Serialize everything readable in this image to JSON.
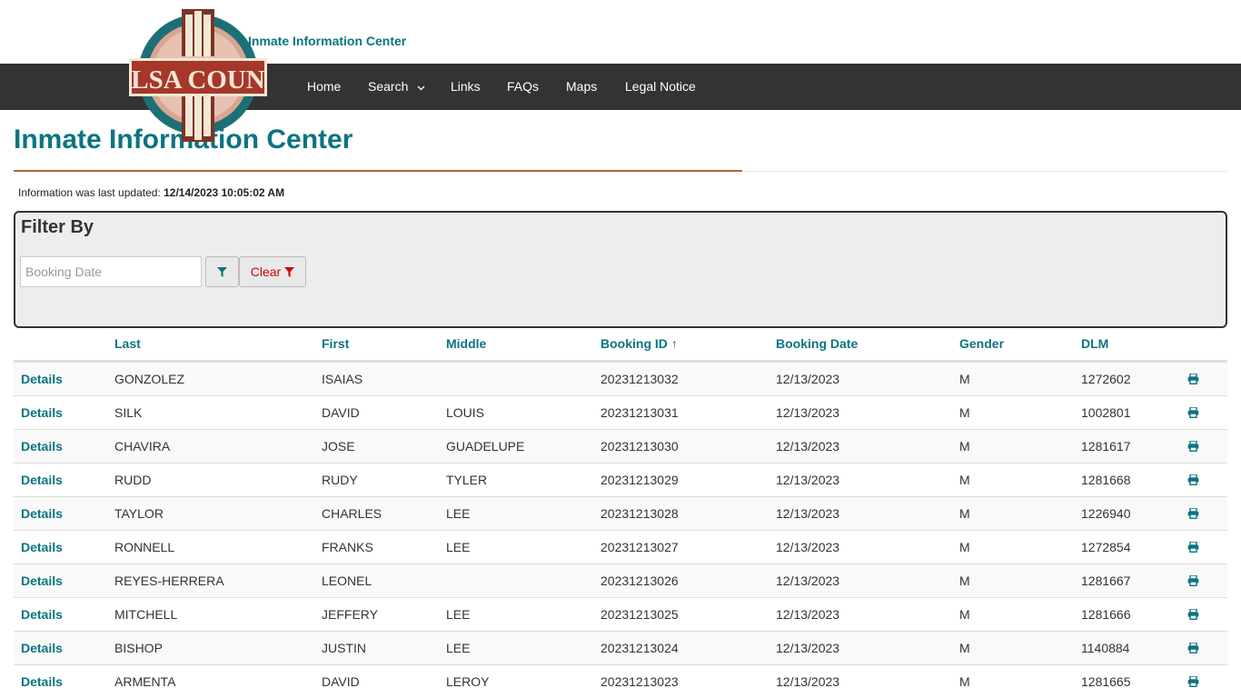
{
  "header": {
    "site_title": "Inmate Information Center",
    "logo_text": "TULSA COUNTY"
  },
  "nav": {
    "items": [
      {
        "label": "Home"
      },
      {
        "label": "Search"
      },
      {
        "label": "Links"
      },
      {
        "label": "FAQs"
      },
      {
        "label": "Maps"
      },
      {
        "label": "Legal Notice"
      }
    ]
  },
  "page": {
    "title": "Inmate Information Center",
    "updated_label": "Information was last updated:",
    "updated_value": "12/14/2023 10:05:02 AM"
  },
  "filter": {
    "heading": "Filter By",
    "booking_date_placeholder": "Booking Date",
    "booking_date_value": "",
    "clear_label": "Clear"
  },
  "table": {
    "columns": [
      "Last",
      "First",
      "Middle",
      "Booking ID",
      "Booking Date",
      "Gender",
      "DLM"
    ],
    "sort_indicator": "↑",
    "details_label": "Details",
    "rows": [
      {
        "last": "GONZOLEZ",
        "first": "ISAIAS",
        "middle": "",
        "booking_id": "20231213032",
        "booking_date": "12/13/2023",
        "gender": "M",
        "dlm": "1272602"
      },
      {
        "last": "SILK",
        "first": "DAVID",
        "middle": "LOUIS",
        "booking_id": "20231213031",
        "booking_date": "12/13/2023",
        "gender": "M",
        "dlm": "1002801"
      },
      {
        "last": "CHAVIRA",
        "first": "JOSE",
        "middle": "GUADELUPE",
        "booking_id": "20231213030",
        "booking_date": "12/13/2023",
        "gender": "M",
        "dlm": "1281617"
      },
      {
        "last": "RUDD",
        "first": "RUDY",
        "middle": "TYLER",
        "booking_id": "20231213029",
        "booking_date": "12/13/2023",
        "gender": "M",
        "dlm": "1281668"
      },
      {
        "last": "TAYLOR",
        "first": "CHARLES",
        "middle": "LEE",
        "booking_id": "20231213028",
        "booking_date": "12/13/2023",
        "gender": "M",
        "dlm": "1226940"
      },
      {
        "last": "RONNELL",
        "first": "FRANKS",
        "middle": "LEE",
        "booking_id": "20231213027",
        "booking_date": "12/13/2023",
        "gender": "M",
        "dlm": "1272854"
      },
      {
        "last": "REYES-HERRERA",
        "first": "LEONEL",
        "middle": "",
        "booking_id": "20231213026",
        "booking_date": "12/13/2023",
        "gender": "M",
        "dlm": "1281667"
      },
      {
        "last": "MITCHELL",
        "first": "JEFFERY",
        "middle": "LEE",
        "booking_id": "20231213025",
        "booking_date": "12/13/2023",
        "gender": "M",
        "dlm": "1281666"
      },
      {
        "last": "BISHOP",
        "first": "JUSTIN",
        "middle": "LEE",
        "booking_id": "20231213024",
        "booking_date": "12/13/2023",
        "gender": "M",
        "dlm": "1140884"
      },
      {
        "last": "ARMENTA",
        "first": "DAVID",
        "middle": "LEROY",
        "booking_id": "20231213023",
        "booking_date": "12/13/2023",
        "gender": "M",
        "dlm": "1281665"
      }
    ]
  },
  "icons": {
    "filter": "filter-icon",
    "clear_filter": "filter-icon",
    "print": "print-icon",
    "caret": "chevron-down-icon"
  },
  "colors": {
    "accent": "#0b7480",
    "navbar": "#333333",
    "rule": "#b0653a",
    "clear": "#d60000"
  }
}
